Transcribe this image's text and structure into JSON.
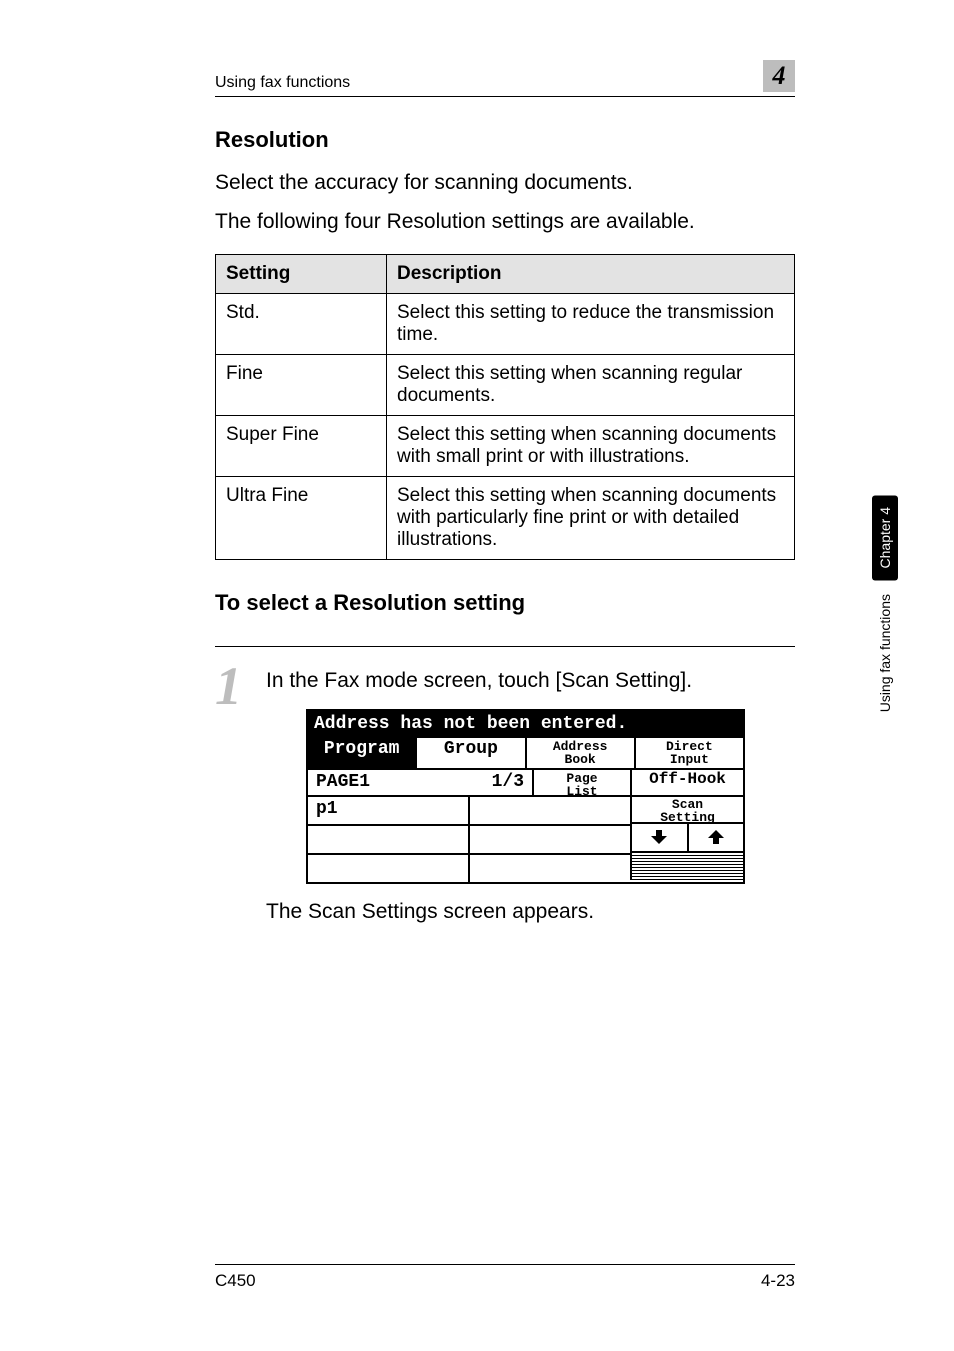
{
  "header": {
    "running_title": "Using fax functions",
    "chapter_number": "4"
  },
  "sidebar": {
    "chip": "Chapter 4",
    "label": "Using fax functions"
  },
  "section": {
    "title": "Resolution",
    "intro1": "Select the accuracy for scanning documents.",
    "intro2": "The following four Resolution settings are available."
  },
  "table": {
    "headers": {
      "setting": "Setting",
      "description": "Description"
    },
    "rows": [
      {
        "setting": "Std.",
        "description": "Select this setting to reduce the transmission time."
      },
      {
        "setting": "Fine",
        "description": "Select this setting when scanning regular documents."
      },
      {
        "setting": "Super Fine",
        "description": "Select this setting when scanning documents with small print or with illustrations."
      },
      {
        "setting": "Ultra Fine",
        "description": "Select this setting when scanning documents with particularly fine print or with detailed illustrations."
      }
    ]
  },
  "procedure": {
    "title": "To select a Resolution setting",
    "step_number": "1",
    "step_text": "In the Fax mode screen, touch [Scan Setting].",
    "result_text": "The Scan Settings screen appears."
  },
  "screen": {
    "status": "Address has not been entered.",
    "tabs": {
      "program": "Program",
      "group": "Group",
      "address_book_l1": "Address",
      "address_book_l2": "Book",
      "direct_l1": "Direct",
      "direct_l2": "Input"
    },
    "page_label": "PAGE1",
    "page_count": "1/3",
    "page_list_l1": "Page",
    "page_list_l2": "List",
    "off_hook": "Off-Hook",
    "entry": "p1",
    "scan_l1": "Scan",
    "scan_l2": "Setting",
    "arrow_down": "↓",
    "arrow_up": "↑"
  },
  "footer": {
    "model": "C450",
    "page": "4-23"
  }
}
